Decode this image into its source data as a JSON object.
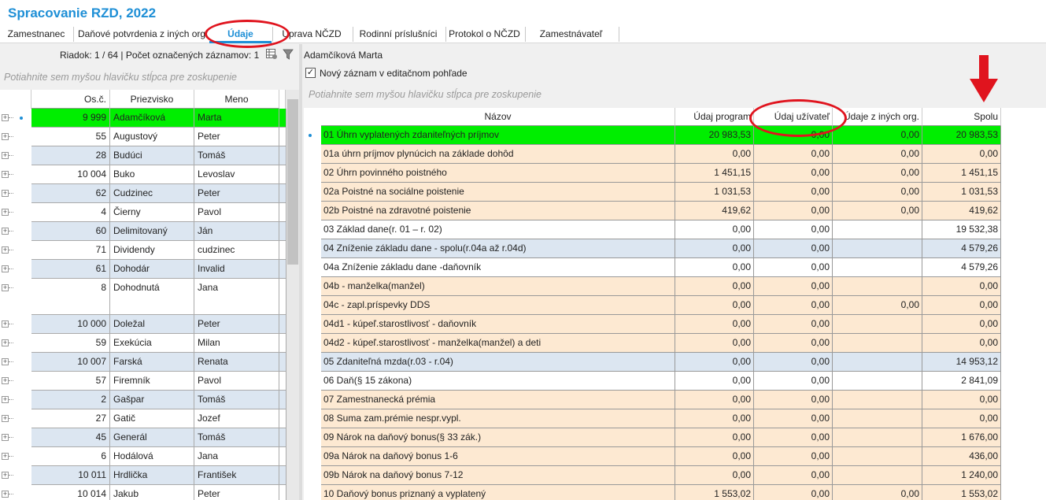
{
  "app_title": "Spracovanie RZD, 2022",
  "tabs": [
    {
      "label": "Zamestnanec",
      "active": false
    },
    {
      "label": "Daňové potvrdenia z iných org",
      "active": false
    },
    {
      "label": "Údaje",
      "active": true
    },
    {
      "label": "Úprava NČZD",
      "active": false
    },
    {
      "label": "Rodinní príslušníci",
      "active": false
    },
    {
      "label": "Protokol o NČZD",
      "active": false
    },
    {
      "label": "Zamestnávateľ",
      "active": false
    }
  ],
  "left": {
    "status": "Riadok: 1 / 64 | Počet označených záznamov: 1",
    "group_hint": "Potiahnite sem myšou hlavičku stĺpca pre zoskupenie",
    "columns": [
      "Os.č.",
      "Priezvisko",
      "Meno"
    ],
    "rows": [
      {
        "osc": "9 999",
        "priezvisko": "Adamčíková",
        "meno": "Marta",
        "style": "selected"
      },
      {
        "osc": "55",
        "priezvisko": "Augustový",
        "meno": "Peter",
        "style": "white"
      },
      {
        "osc": "28",
        "priezvisko": "Budúci",
        "meno": "Tomáš",
        "style": "blue"
      },
      {
        "osc": "10 004",
        "priezvisko": "Buko",
        "meno": "Levoslav",
        "style": "white"
      },
      {
        "osc": "62",
        "priezvisko": "Cudzinec",
        "meno": "Peter",
        "style": "blue"
      },
      {
        "osc": "4",
        "priezvisko": "Čierny",
        "meno": "Pavol",
        "style": "white"
      },
      {
        "osc": "60",
        "priezvisko": "Delimitovaný",
        "meno": "Ján",
        "style": "blue"
      },
      {
        "osc": "71",
        "priezvisko": "Dividendy",
        "meno": "cudzinec",
        "style": "white"
      },
      {
        "osc": "61",
        "priezvisko": "Dohodár",
        "meno": "Invalid",
        "style": "blue"
      },
      {
        "osc": "8",
        "priezvisko": "Dohodnutá",
        "meno": "Jana",
        "style": "white",
        "tall": true
      },
      {
        "osc": "10 000",
        "priezvisko": "Doležal",
        "meno": "Peter",
        "style": "blue"
      },
      {
        "osc": "59",
        "priezvisko": "Exekúcia",
        "meno": "Milan",
        "style": "white"
      },
      {
        "osc": "10 007",
        "priezvisko": "Farská",
        "meno": "Renata",
        "style": "blue"
      },
      {
        "osc": "57",
        "priezvisko": "Firemník",
        "meno": "Pavol",
        "style": "white"
      },
      {
        "osc": "2",
        "priezvisko": "Gašpar",
        "meno": "Tomáš",
        "style": "blue"
      },
      {
        "osc": "27",
        "priezvisko": "Gatič",
        "meno": "Jozef",
        "style": "white"
      },
      {
        "osc": "45",
        "priezvisko": "Generál",
        "meno": "Tomáš",
        "style": "blue"
      },
      {
        "osc": "6",
        "priezvisko": "Hodálová",
        "meno": "Jana",
        "style": "white"
      },
      {
        "osc": "10 011",
        "priezvisko": "Hrdlička",
        "meno": "František",
        "style": "blue"
      },
      {
        "osc": "10 014",
        "priezvisko": "Jakub",
        "meno": "Peter",
        "style": "white"
      }
    ]
  },
  "right": {
    "employee_name": "Adamčíková Marta",
    "checkbox_label": "Nový záznam v editačnom pohľade",
    "checkbox_checked": true,
    "group_hint": "Potiahnite sem myšou hlavičku stĺpca pre zoskupenie",
    "columns": [
      "Názov",
      "Údaj program",
      "Údaj užívateľ",
      "Údaje z iných org.",
      "Spolu"
    ],
    "rows": [
      {
        "nazov": "01 Úhrn vyplatených zdaniteľných príjmov",
        "program": "20 983,53",
        "uzivatel": "0,00",
        "ine": "0,00",
        "spolu": "20 983,53",
        "style": "selected"
      },
      {
        "nazov": "01a úhrn príjmov plynúcich na základe dohôd",
        "program": "0,00",
        "uzivatel": "0,00",
        "ine": "0,00",
        "spolu": "0,00",
        "style": "tan"
      },
      {
        "nazov": "02 Úhrn povinného poistného",
        "program": "1 451,15",
        "uzivatel": "0,00",
        "ine": "0,00",
        "spolu": "1 451,15",
        "style": "tan"
      },
      {
        "nazov": "02a Poistné na sociálne poistenie",
        "program": "1 031,53",
        "uzivatel": "0,00",
        "ine": "0,00",
        "spolu": "1 031,53",
        "style": "tan"
      },
      {
        "nazov": "02b Poistné na zdravotné poistenie",
        "program": "419,62",
        "uzivatel": "0,00",
        "ine": "0,00",
        "spolu": "419,62",
        "style": "tan"
      },
      {
        "nazov": "03 Základ dane(r. 01 – r. 02)",
        "program": "0,00",
        "uzivatel": "0,00",
        "ine": "",
        "spolu": "19 532,38",
        "style": "white"
      },
      {
        "nazov": "04 Zníženie základu dane - spolu(r.04a až r.04d)",
        "program": "0,00",
        "uzivatel": "0,00",
        "ine": "",
        "spolu": "4 579,26",
        "style": "blue"
      },
      {
        "nazov": "04a Zníženie základu dane -daňovník",
        "program": "0,00",
        "uzivatel": "0,00",
        "ine": "",
        "spolu": "4 579,26",
        "style": "white"
      },
      {
        "nazov": "04b - manželka(manžel)",
        "program": "0,00",
        "uzivatel": "0,00",
        "ine": "",
        "spolu": "0,00",
        "style": "tan"
      },
      {
        "nazov": "04c - zapl.príspevky DDS",
        "program": "0,00",
        "uzivatel": "0,00",
        "ine": "0,00",
        "spolu": "0,00",
        "style": "tan"
      },
      {
        "nazov": "04d1 - kúpeľ.starostlivosť - daňovník",
        "program": "0,00",
        "uzivatel": "0,00",
        "ine": "",
        "spolu": "0,00",
        "style": "tan"
      },
      {
        "nazov": "04d2 - kúpeľ.starostlivosť - manželka(manžel) a deti",
        "program": "0,00",
        "uzivatel": "0,00",
        "ine": "",
        "spolu": "0,00",
        "style": "tan"
      },
      {
        "nazov": "05 Zdaniteľná mzda(r.03 - r.04)",
        "program": "0,00",
        "uzivatel": "0,00",
        "ine": "",
        "spolu": "14 953,12",
        "style": "blue"
      },
      {
        "nazov": "06 Daň(§ 15 zákona)",
        "program": "0,00",
        "uzivatel": "0,00",
        "ine": "",
        "spolu": "2 841,09",
        "style": "white"
      },
      {
        "nazov": "07 Zamestnanecká prémia",
        "program": "0,00",
        "uzivatel": "0,00",
        "ine": "",
        "spolu": "0,00",
        "style": "tan"
      },
      {
        "nazov": "08 Suma zam.prémie nespr.vypl.",
        "program": "0,00",
        "uzivatel": "0,00",
        "ine": "",
        "spolu": "0,00",
        "style": "tan"
      },
      {
        "nazov": "09 Nárok na daňový bonus(§ 33 zák.)",
        "program": "0,00",
        "uzivatel": "0,00",
        "ine": "",
        "spolu": "1 676,00",
        "style": "tan"
      },
      {
        "nazov": "09a Nárok na daňový bonus 1-6",
        "program": "0,00",
        "uzivatel": "0,00",
        "ine": "",
        "spolu": "436,00",
        "style": "tan"
      },
      {
        "nazov": "09b Nárok na daňový bonus 7-12",
        "program": "0,00",
        "uzivatel": "0,00",
        "ine": "",
        "spolu": "1 240,00",
        "style": "tan"
      },
      {
        "nazov": "10 Daňový bonus priznaný a vyplatený",
        "program": "1 553,02",
        "uzivatel": "0,00",
        "ine": "0,00",
        "spolu": "1 553,02",
        "style": "tan"
      }
    ]
  },
  "colors": {
    "accent": "#1e8fd6",
    "selected_row": "#00ee00",
    "row_blue": "#dce6f1",
    "row_tan": "#fde9d2",
    "annotation_red": "#e0141e"
  }
}
